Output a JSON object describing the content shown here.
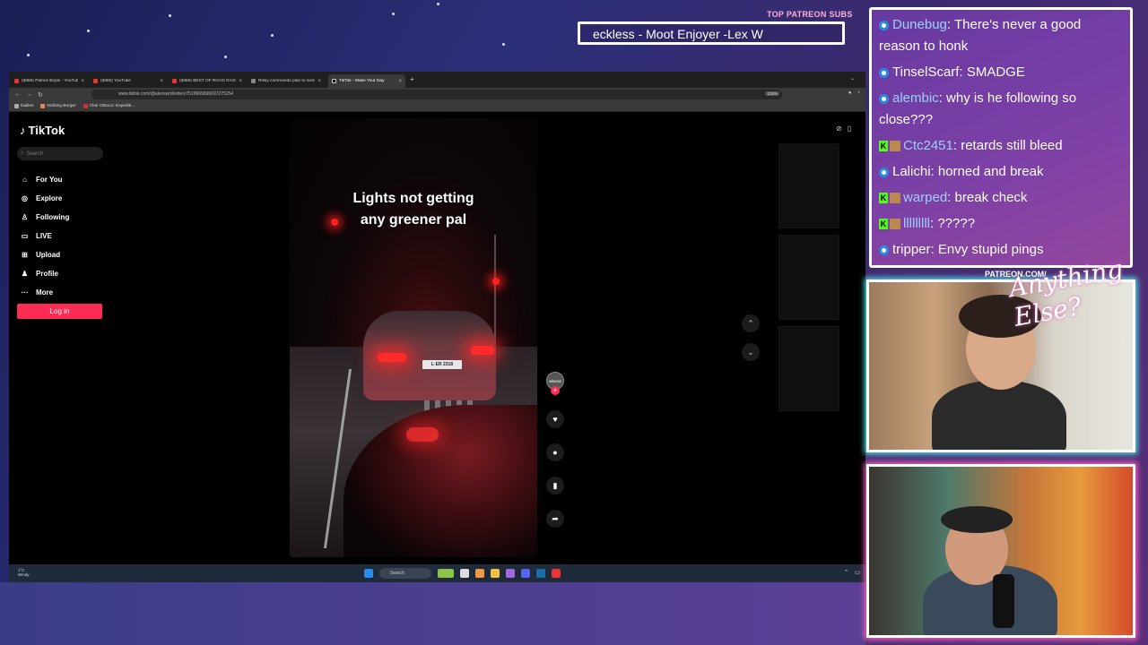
{
  "overlay": {
    "ticker_label": "TOP PATREON SUBS",
    "ticker_text": "eckless - Moot Enjoyer -Lex W",
    "patreon_url": "PATREON.COM/",
    "logo_text": "Anything Else?"
  },
  "browser": {
    "tabs": [
      {
        "label": "(6868) Patrick Boyle - YouTube",
        "favicon": "youtube-icon"
      },
      {
        "label": "(6868) YouTube",
        "favicon": "youtube-icon"
      },
      {
        "label": "(6868) BEST OF ROAD RAGE | U",
        "favicon": "youtube-icon"
      },
      {
        "label": "Risky commando plan to seize",
        "favicon": "page-icon"
      },
      {
        "label": "TikTok - Make Your Day",
        "favicon": "tiktok-icon",
        "active": true
      }
    ],
    "url": "www.tiktok.com/@alexswrd/video/7510669696697275254",
    "zoom": "125%",
    "bookmarks": [
      "Dailies",
      "Nothing Burger",
      "Clair Obscur: Expediti..."
    ]
  },
  "tiktok": {
    "logo": "TikTok",
    "search_placeholder": "Search",
    "nav": [
      {
        "label": "For You",
        "icon": "home-icon"
      },
      {
        "label": "Explore",
        "icon": "compass-icon"
      },
      {
        "label": "Following",
        "icon": "users-icon"
      },
      {
        "label": "LIVE",
        "icon": "live-icon"
      },
      {
        "label": "Upload",
        "icon": "plus-square-icon"
      },
      {
        "label": "Profile",
        "icon": "person-icon"
      },
      {
        "label": "More",
        "icon": "more-icon"
      }
    ],
    "login_label": "Log in",
    "video_caption_line1": "Lights not getting",
    "video_caption_line2": "any greener pal",
    "plate": "L·ER 2318",
    "creator_handle": "alexsw",
    "accent": "#fe2c55"
  },
  "taskbar": {
    "weather_temp": "1°C",
    "weather_desc": "Windy",
    "search_label": "Search"
  },
  "chat": [
    {
      "user": "Dunebug",
      "message": "There's never a good reason to honk",
      "badges": [
        "blue"
      ],
      "color": "blue"
    },
    {
      "user": "TinselScarf",
      "message": "SMADGE",
      "badges": [
        "blue"
      ],
      "color": "white"
    },
    {
      "user": "alembic",
      "message": "why is he following so close???",
      "badges": [
        "blue"
      ],
      "color": "blue"
    },
    {
      "user": "Ctc2451",
      "message": "retards still bleed",
      "badges": [
        "kick",
        "pixel"
      ],
      "color": "blue"
    },
    {
      "user": "Lalichi",
      "message": "horned and break",
      "badges": [
        "blue"
      ],
      "color": "white"
    },
    {
      "user": "warped",
      "message": "break check",
      "badges": [
        "kick",
        "pixel"
      ],
      "color": "blue"
    },
    {
      "user": "lllllllll",
      "message": "?????",
      "badges": [
        "kick",
        "pixel"
      ],
      "color": "blue"
    },
    {
      "user": "tripper",
      "message": "Envy stupid pings",
      "badges": [
        "blue"
      ],
      "color": "white"
    }
  ]
}
